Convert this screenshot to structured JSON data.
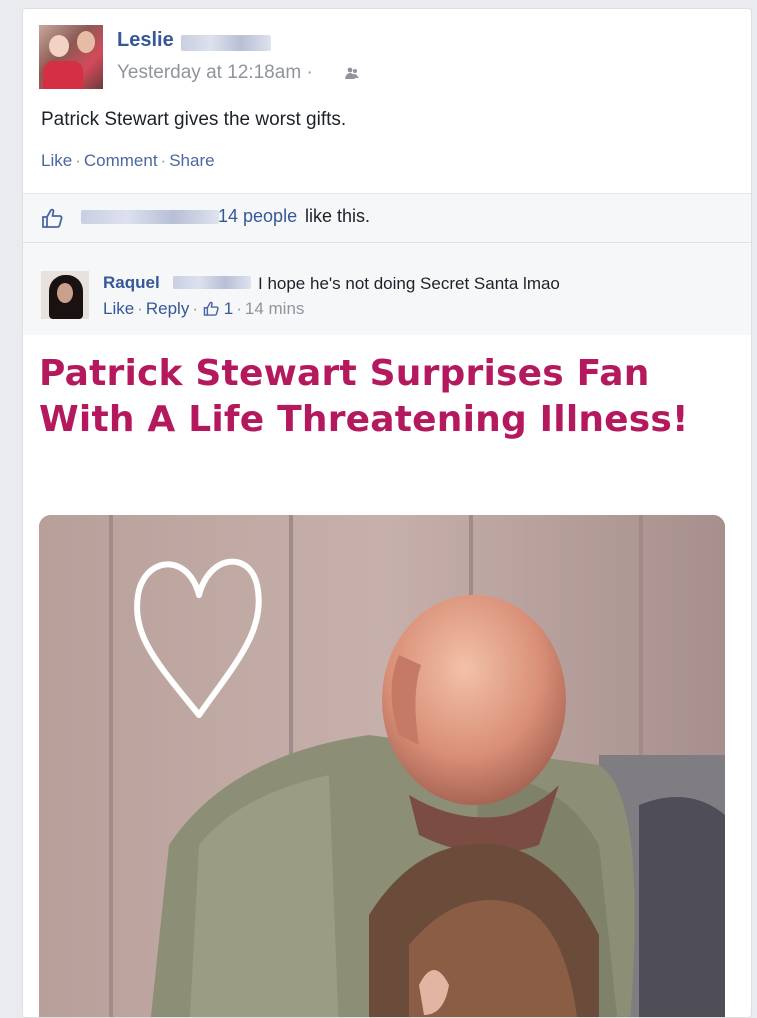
{
  "post": {
    "author": "Leslie",
    "timestamp": "Yesterday at 12:18am",
    "separator": "·",
    "text": "Patrick Stewart gives the worst gifts.",
    "actions": {
      "like": "Like",
      "comment": "Comment",
      "share": "Share"
    }
  },
  "likes": {
    "count_link": "14 people",
    "suffix": "like this."
  },
  "comment": {
    "author": "Raquel",
    "text": "I hope he's not doing Secret Santa lmao",
    "like": "Like",
    "reply": "Reply",
    "like_count": "1",
    "time": "14 mins"
  },
  "article": {
    "headline": "Patrick Stewart Surprises Fan With A Life Threatening Illness!"
  },
  "colors": {
    "link": "#365899",
    "headline": "#b5195d",
    "muted": "#90949c"
  },
  "icons": [
    "friends-icon",
    "thumbs-up-icon",
    "heart-doodle"
  ]
}
